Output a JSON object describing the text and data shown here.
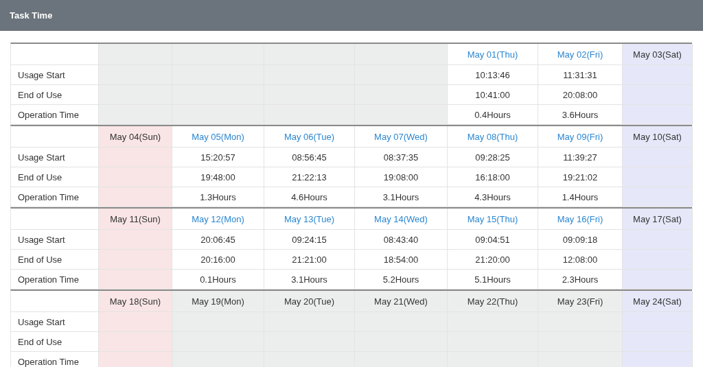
{
  "title": "Task Time",
  "weeks": [
    {
      "row_labels": [
        "Usage Start",
        "End of Use",
        "Operation Time"
      ],
      "days": [
        {
          "kind": "blank"
        },
        {
          "kind": "blank"
        },
        {
          "kind": "blank"
        },
        {
          "kind": "blank"
        },
        {
          "kind": "workday",
          "date": "May 01(Thu)",
          "start": "10:13:46",
          "end": "10:41:00",
          "duration": "0.4Hours"
        },
        {
          "kind": "workday",
          "date": "May 02(Fri)",
          "start": "11:31:31",
          "end": "20:08:00",
          "duration": "3.6Hours"
        },
        {
          "kind": "saturday",
          "date": "May 03(Sat)"
        }
      ]
    },
    {
      "row_labels": [
        "Usage Start",
        "End of Use",
        "Operation Time"
      ],
      "days": [
        {
          "kind": "sunday",
          "date": "May 04(Sun)"
        },
        {
          "kind": "workday",
          "date": "May 05(Mon)",
          "start": "15:20:57",
          "end": "19:48:00",
          "duration": "1.3Hours"
        },
        {
          "kind": "workday",
          "date": "May 06(Tue)",
          "start": "08:56:45",
          "end": "21:22:13",
          "duration": "4.6Hours"
        },
        {
          "kind": "workday",
          "date": "May 07(Wed)",
          "start": "08:37:35",
          "end": "19:08:00",
          "duration": "3.1Hours"
        },
        {
          "kind": "workday",
          "date": "May 08(Thu)",
          "start": "09:28:25",
          "end": "16:18:00",
          "duration": "4.3Hours"
        },
        {
          "kind": "workday",
          "date": "May 09(Fri)",
          "start": "11:39:27",
          "end": "19:21:02",
          "duration": "1.4Hours"
        },
        {
          "kind": "saturday",
          "date": "May 10(Sat)"
        }
      ]
    },
    {
      "row_labels": [
        "Usage Start",
        "End of Use",
        "Operation Time"
      ],
      "days": [
        {
          "kind": "sunday",
          "date": "May 11(Sun)"
        },
        {
          "kind": "workday",
          "date": "May 12(Mon)",
          "start": "20:06:45",
          "end": "20:16:00",
          "duration": "0.1Hours"
        },
        {
          "kind": "workday",
          "date": "May 13(Tue)",
          "start": "09:24:15",
          "end": "21:21:00",
          "duration": "3.1Hours"
        },
        {
          "kind": "workday",
          "date": "May 14(Wed)",
          "start": "08:43:40",
          "end": "18:54:00",
          "duration": "5.2Hours"
        },
        {
          "kind": "workday",
          "date": "May 15(Thu)",
          "start": "09:04:51",
          "end": "21:20:00",
          "duration": "5.1Hours"
        },
        {
          "kind": "workday",
          "date": "May 16(Fri)",
          "start": "09:09:18",
          "end": "12:08:00",
          "duration": "2.3Hours"
        },
        {
          "kind": "saturday",
          "date": "May 17(Sat)"
        }
      ]
    },
    {
      "row_labels": [
        "Usage Start",
        "End of Use",
        "Operation Time"
      ],
      "days": [
        {
          "kind": "sunday",
          "date": "May 18(Sun)"
        },
        {
          "kind": "blank",
          "date": "May 19(Mon)"
        },
        {
          "kind": "blank",
          "date": "May 20(Tue)"
        },
        {
          "kind": "blank",
          "date": "May 21(Wed)"
        },
        {
          "kind": "blank",
          "date": "May 22(Thu)"
        },
        {
          "kind": "blank",
          "date": "May 23(Fri)"
        },
        {
          "kind": "saturday",
          "date": "May 24(Sat)"
        }
      ]
    }
  ]
}
